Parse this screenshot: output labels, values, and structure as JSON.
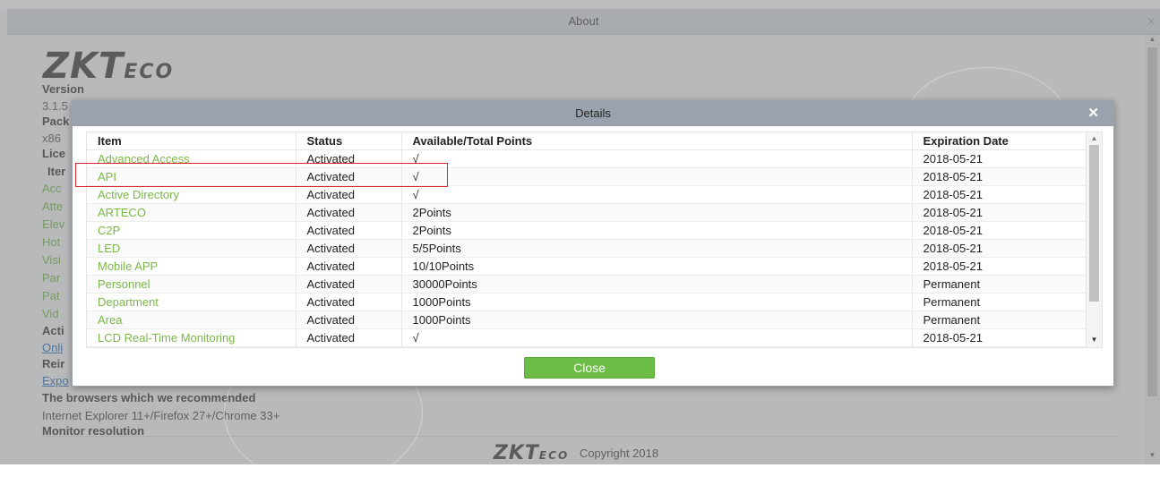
{
  "about": {
    "title": "About",
    "close_glyph": "✕",
    "logo_main": "ZKT",
    "logo_tail": "ECO",
    "version_label": "Version",
    "version_value": "3.1.5",
    "package_label": "Pack",
    "arch_value": "x86",
    "license_label": "Lice",
    "item_col_label": "Iter",
    "partial_items": [
      "Acc",
      "Atte",
      "Elev",
      "Hot",
      "Visi",
      "Par",
      "Pat",
      "Vid"
    ],
    "activation_label": "Acti",
    "online_link": "Onli",
    "reinstall_label": "Reir",
    "export_link": "Expo",
    "browsers_heading": "The browsers which we recommended",
    "browsers_value": "Internet Explorer 11+/Firefox 27+/Chrome 33+",
    "monitor_heading": "Monitor resolution",
    "copyright": "Copyright 2018"
  },
  "details": {
    "title": "Details",
    "close_glyph": "✕",
    "columns": [
      "Item",
      "Status",
      "Available/Total Points",
      "Expiration Date"
    ],
    "rows": [
      {
        "item": "Advanced Access",
        "status": "Activated",
        "points": "√",
        "expiration": "2018-05-21"
      },
      {
        "item": "API",
        "status": "Activated",
        "points": "√",
        "expiration": "2018-05-21"
      },
      {
        "item": "Active Directory",
        "status": "Activated",
        "points": "√",
        "expiration": "2018-05-21"
      },
      {
        "item": "ARTECO",
        "status": "Activated",
        "points": "2Points",
        "expiration": "2018-05-21"
      },
      {
        "item": "C2P",
        "status": "Activated",
        "points": "2Points",
        "expiration": "2018-05-21"
      },
      {
        "item": "LED",
        "status": "Activated",
        "points": "5/5Points",
        "expiration": "2018-05-21"
      },
      {
        "item": "Mobile APP",
        "status": "Activated",
        "points": "10/10Points",
        "expiration": "2018-05-21"
      },
      {
        "item": "Personnel",
        "status": "Activated",
        "points": "30000Points",
        "expiration": "Permanent"
      },
      {
        "item": "Department",
        "status": "Activated",
        "points": "1000Points",
        "expiration": "Permanent"
      },
      {
        "item": "Area",
        "status": "Activated",
        "points": "1000Points",
        "expiration": "Permanent"
      },
      {
        "item": "LCD Real-Time Monitoring",
        "status": "Activated",
        "points": "√",
        "expiration": "2018-05-21"
      }
    ],
    "close_button_label": "Close",
    "highlighted_row_index": 1
  },
  "colors": {
    "accent_green": "#6cbd45",
    "item_text_green": "#7ab648",
    "highlight_red": "#d9262b",
    "dialog_title_bar": "#9aa3ad"
  }
}
